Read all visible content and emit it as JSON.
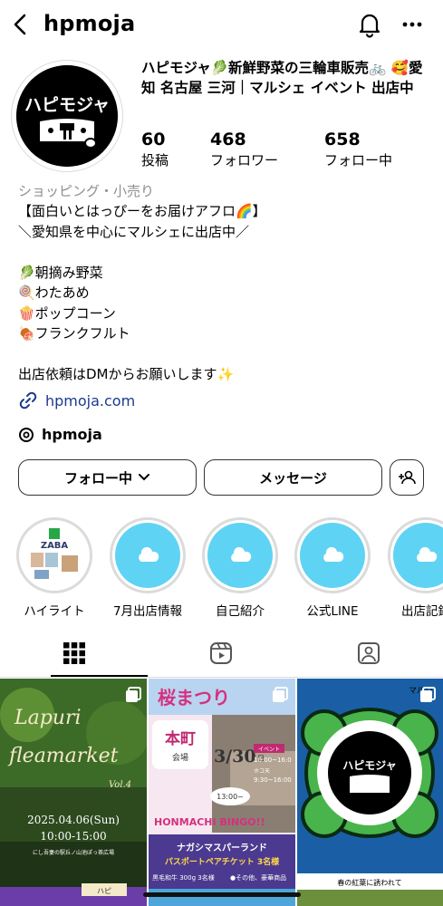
{
  "header": {
    "username": "hpmoja",
    "back_icon": "chevron-left-icon",
    "bell_icon": "bell-icon",
    "more_icon": "more-horizontal-icon"
  },
  "profile": {
    "avatar_text": "ハピモジャ",
    "display_name": "ハピモジャ🥬新鮮野菜の三輪車販売🚲 🥰愛知 名古屋 三河｜マルシェ イベント 出店中",
    "stats": [
      {
        "value": "60",
        "label": "投稿"
      },
      {
        "value": "468",
        "label": "フォロワー"
      },
      {
        "value": "658",
        "label": "フォロー中"
      }
    ],
    "category": "ショッピング・小売り",
    "bio": "【面白いとはっぴーをお届けアフロ🌈】\n＼愛知県を中心にマルシェに出店中／\n\n🥬朝摘み野菜\n🍭わたあめ\n🍿ポップコーン\n🍖フランクフルト\n\n出店依頼はDMからお願いします✨",
    "link": "hpmoja.com",
    "threads": "hpmoja"
  },
  "buttons": {
    "follow": "フォロー中",
    "message": "メッセージ"
  },
  "highlights": [
    {
      "label": "ハイライト",
      "cover_text": "ZABA"
    },
    {
      "label": "7月出店情報"
    },
    {
      "label": "自己紹介"
    },
    {
      "label": "公式LINE"
    },
    {
      "label": "出店記録"
    }
  ],
  "posts": [
    {
      "title_line1": "Lapuri",
      "title_line2": "fleamarket",
      "vol": "Vol.4",
      "date": "2025.04.06(Sun)",
      "time": "10:00-15:00",
      "venue": "にし吾妻の駅丘ノ山池ぽっ茶広場",
      "tag": "ハピ"
    },
    {
      "title_top": "桜まつり",
      "place": "本町",
      "place_sub": "会場",
      "date": "3/30",
      "date_day": "日",
      "event_label": "イベント",
      "time1": "10:00~16:0",
      "time2": "9:30~16:00",
      "hoko": "ホコ天",
      "start": "13:00~",
      "bingo": "HONMACHI BINGO!!",
      "prize1": "ナガシマスパーランド",
      "prize2": "パスポートペアチケット 3名様",
      "prize3": "黒毛和牛 300g 3名様",
      "prize4": "●その他、豪華商品"
    },
    {
      "logo_text": "ハピモジャ",
      "top_text": "マルシ",
      "bottom_text": "春の紅葉に誘われて"
    }
  ],
  "colors": {
    "highlight_fill": "#5fd3f3",
    "link": "#1a3a8f",
    "muted": "#8e8e8e"
  }
}
